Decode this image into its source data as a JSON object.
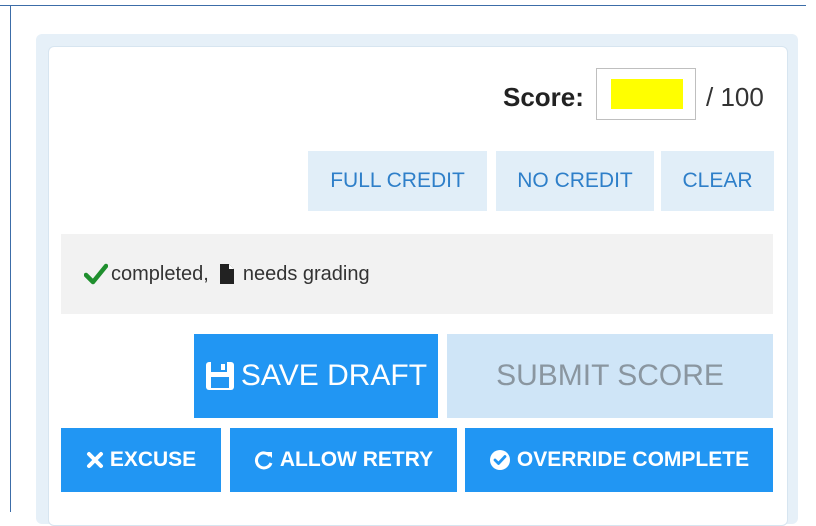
{
  "score": {
    "label": "Score:",
    "max": "/ 100",
    "input_value": "",
    "input_color": "#ffff00"
  },
  "credit_buttons": {
    "full_credit": "FULL CREDIT",
    "no_credit": "NO CREDIT",
    "clear": "CLEAR"
  },
  "status": {
    "completed": "completed,",
    "needs_grading": "needs grading",
    "check_icon": "check-icon",
    "doc_icon": "document-icon",
    "check_color": "#1f8f2e"
  },
  "actions": {
    "save_draft": "SAVE DRAFT",
    "submit_score": "SUBMIT SCORE",
    "excuse": "EXCUSE",
    "allow_retry": "ALLOW RETRY",
    "override_complete": "OVERRIDE COMPLETE"
  },
  "colors": {
    "primary": "#2196f3",
    "light_button": "#e1eef8",
    "light_button_text": "#2e7fc9",
    "disabled_button": "#cfe5f7"
  }
}
